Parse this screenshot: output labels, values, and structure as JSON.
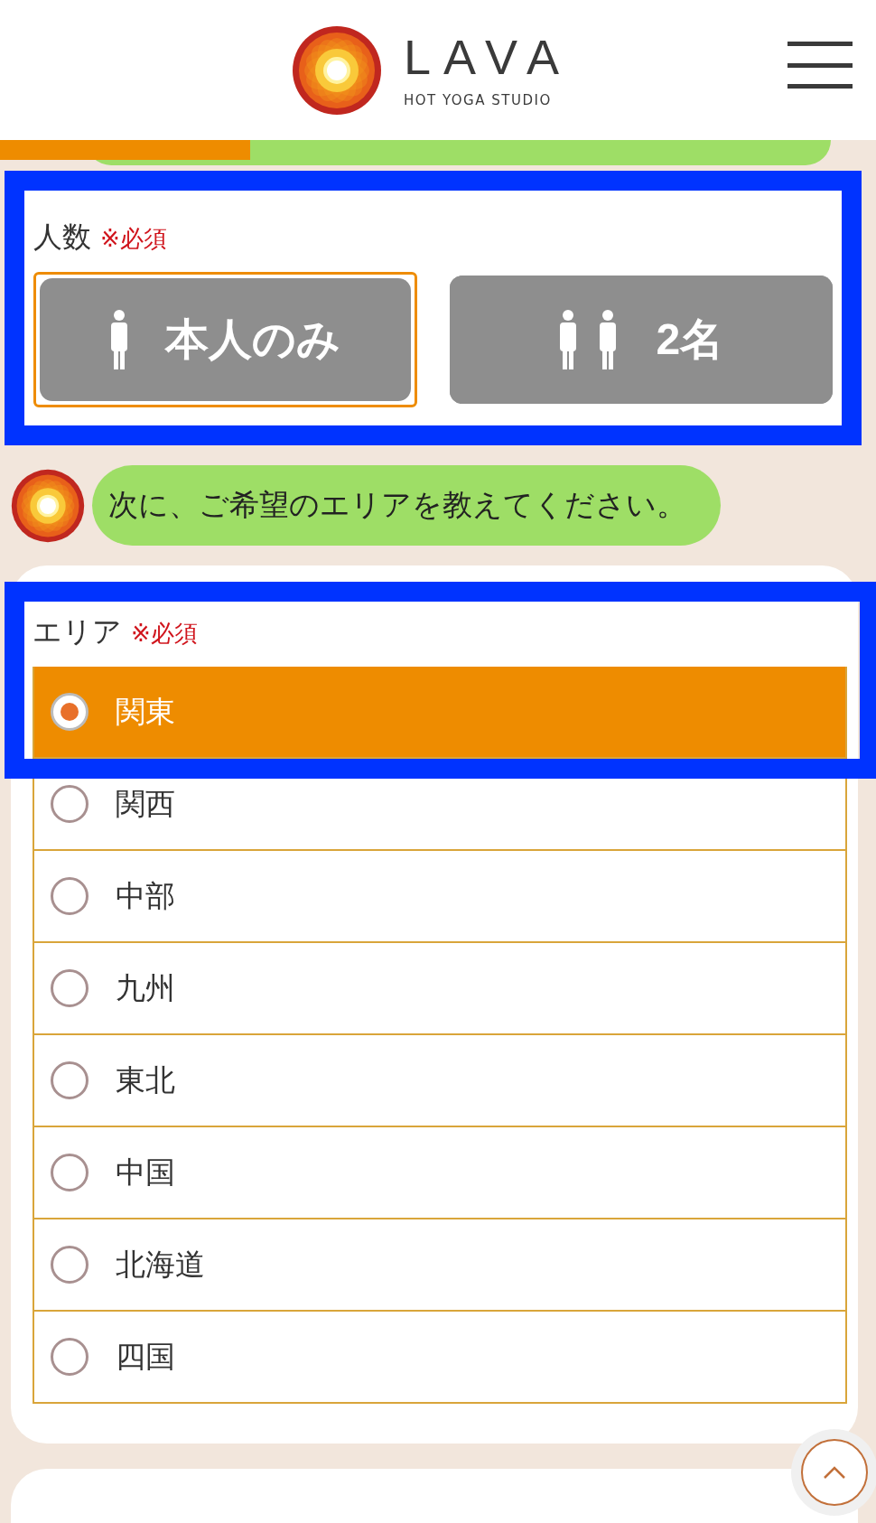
{
  "header": {
    "brand": "LAVA",
    "tagline": "HOT YOGA STUDIO"
  },
  "people": {
    "label": "人数",
    "required": "※必須",
    "options": [
      {
        "label": "本人のみ",
        "kind": "single",
        "selected": true
      },
      {
        "label": "2名",
        "kind": "pair",
        "selected": false
      }
    ]
  },
  "message": {
    "text": "次に、ご希望のエリアを教えてください。"
  },
  "area": {
    "label": "エリア",
    "required": "※必須",
    "options": [
      {
        "label": "関東",
        "selected": true
      },
      {
        "label": "関西",
        "selected": false
      },
      {
        "label": "中部",
        "selected": false
      },
      {
        "label": "九州",
        "selected": false
      },
      {
        "label": "東北",
        "selected": false
      },
      {
        "label": "中国",
        "selected": false
      },
      {
        "label": "北海道",
        "selected": false
      },
      {
        "label": "四国",
        "selected": false
      }
    ]
  }
}
